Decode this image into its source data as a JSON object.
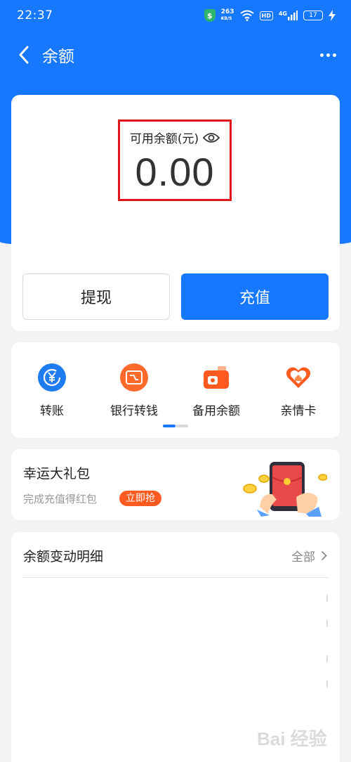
{
  "status_bar": {
    "time": "22:37",
    "speed_value": "263",
    "speed_unit": "KB/S",
    "hd": "HD",
    "network": "4G",
    "battery": "17"
  },
  "nav": {
    "title": "余额"
  },
  "balance": {
    "label": "可用余额(元)",
    "amount": "0.00"
  },
  "buttons": {
    "withdraw": "提现",
    "recharge": "充值"
  },
  "actions": [
    {
      "label": "转账",
      "icon": "yuan-transfer-icon"
    },
    {
      "label": "银行转钱",
      "icon": "bank-card-icon"
    },
    {
      "label": "备用余额",
      "icon": "wallet-icon"
    },
    {
      "label": "亲情卡",
      "icon": "heart-home-icon"
    }
  ],
  "pager": {
    "pages": 2,
    "current": 1
  },
  "lucky": {
    "title": "幸运大礼包",
    "subtitle": "完成充值得红包",
    "tag": "立即抢"
  },
  "details": {
    "title": "余额变动明细",
    "all": "全部"
  },
  "watermark": {
    "text": "Bai 经验"
  },
  "colors": {
    "brand_blue": "#1677ff",
    "orange": "#ff5a1f",
    "highlight_red": "#e0151b"
  }
}
